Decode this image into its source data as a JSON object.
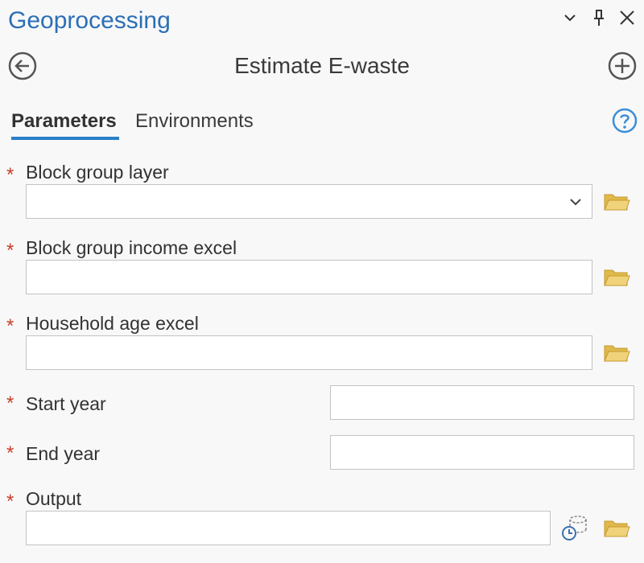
{
  "header": {
    "pane_title": "Geoprocessing",
    "tool_title": "Estimate E-waste"
  },
  "tabs": [
    {
      "label": "Parameters",
      "active": true
    },
    {
      "label": "Environments",
      "active": false
    }
  ],
  "required_marker": "*",
  "parameters": [
    {
      "label": "Block group layer",
      "value": "",
      "type": "dropdown"
    },
    {
      "label": "Block group income excel",
      "value": "",
      "type": "file"
    },
    {
      "label": "Household age excel",
      "value": "",
      "type": "file"
    },
    {
      "label": "Start year",
      "value": "",
      "type": "number"
    },
    {
      "label": "End year",
      "value": "",
      "type": "number"
    },
    {
      "label": "Output",
      "value": "",
      "type": "output"
    }
  ],
  "icons": {
    "back": "back-arrow-circle-icon",
    "add": "plus-circle-icon",
    "help": "question-circle-icon",
    "browse": "folder-icon",
    "dataset": "dataset-icon",
    "dropdown": "chevron-down-icon",
    "pane_menu": "chevron-down-icon",
    "pin": "pin-icon",
    "close": "close-icon"
  },
  "colors": {
    "accent": "#2b7fc7",
    "title": "#2b6fb6",
    "required": "#c8402a",
    "folder": "#e0b94a"
  }
}
